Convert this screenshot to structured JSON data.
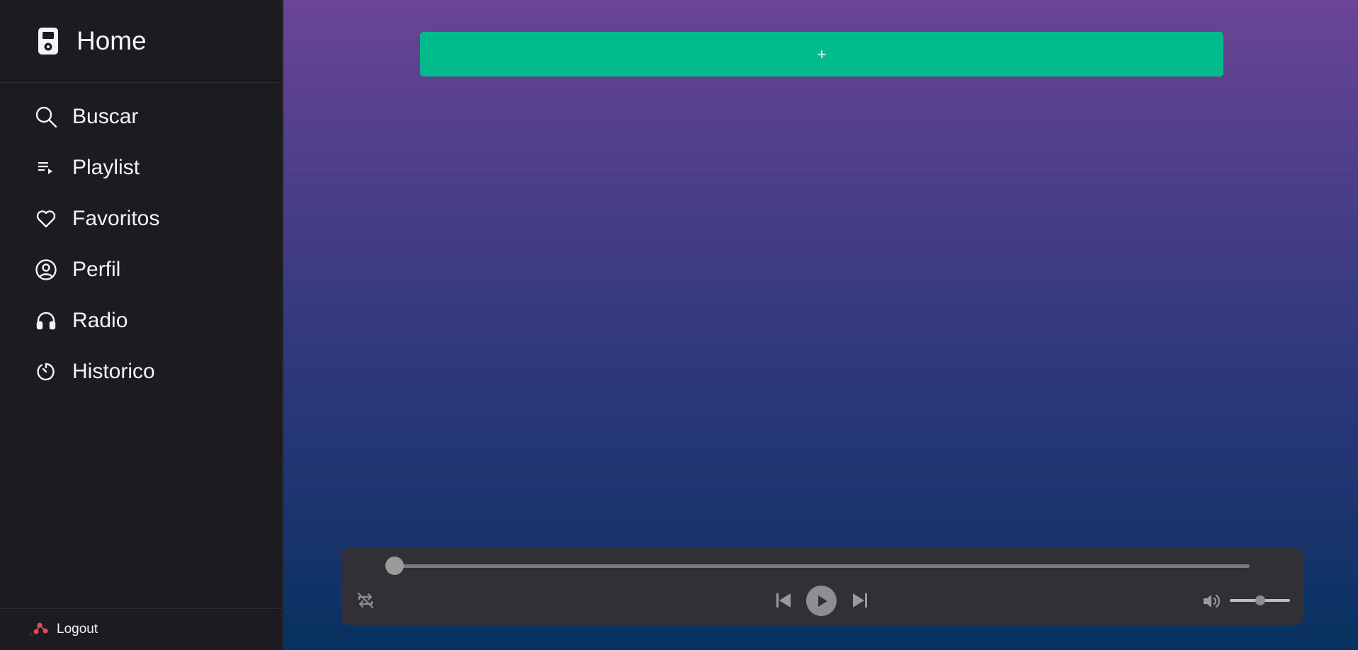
{
  "sidebar": {
    "brand": {
      "title": "Home",
      "icon": "music-player-icon"
    },
    "items": [
      {
        "label": "Buscar",
        "icon": "search-icon"
      },
      {
        "label": "Playlist",
        "icon": "playlist-icon"
      },
      {
        "label": "Favoritos",
        "icon": "heart-icon"
      },
      {
        "label": "Perfil",
        "icon": "user-circle-icon"
      },
      {
        "label": "Radio",
        "icon": "headphones-icon"
      },
      {
        "label": "Historico",
        "icon": "history-icon"
      }
    ],
    "logout": {
      "label": "Logout",
      "icon": "logout-icon"
    }
  },
  "main": {
    "add_button": {
      "label": "+"
    },
    "background_top": "#6a4595",
    "background_bottom": "#07325f",
    "accent": "#00ba8b"
  },
  "player": {
    "progress": 0,
    "volume": 0.5,
    "controls": {
      "repeat_icon": "repeat-off-icon",
      "prev_icon": "skip-previous-icon",
      "play_icon": "play-icon",
      "next_icon": "skip-next-icon",
      "volume_icon": "volume-icon"
    }
  }
}
